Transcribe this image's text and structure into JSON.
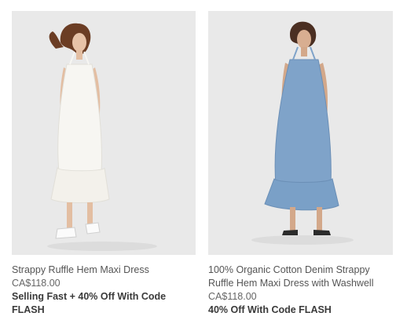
{
  "products": [
    {
      "name": "Strappy Ruffle Hem Maxi Dress",
      "price": "CA$118.00",
      "promo": "Selling Fast + 40% Off With Code FLASH",
      "image_icon": "white-maxi-dress-photo"
    },
    {
      "name": "100% Organic Cotton Denim Strappy Ruffle Hem Maxi Dress with Washwell",
      "price": "CA$118.00",
      "promo": "40% Off With Code FLASH",
      "image_icon": "denim-maxi-dress-photo"
    }
  ],
  "colors": {
    "background": "#ffffff",
    "photo_bg": "#e9e9e9",
    "dress_white": "#f7f6f2",
    "dress_denim": "#7fa3c9"
  }
}
